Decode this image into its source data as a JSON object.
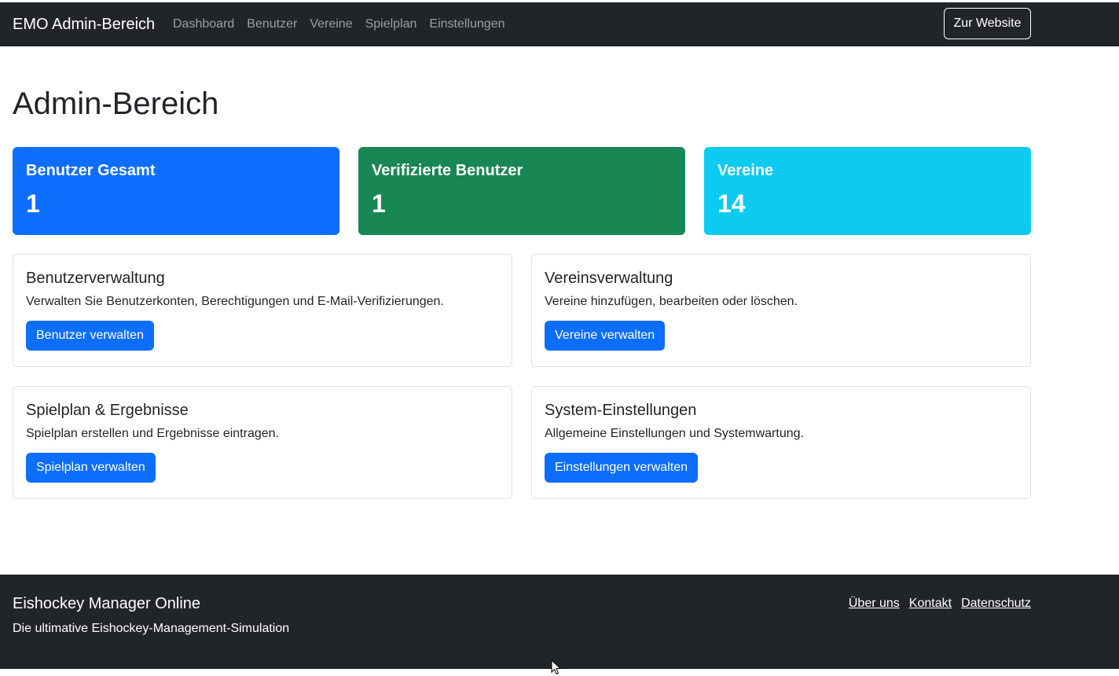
{
  "navbar": {
    "brand": "EMO Admin-Bereich",
    "links": [
      "Dashboard",
      "Benutzer",
      "Vereine",
      "Spielplan",
      "Einstellungen"
    ],
    "website_button": "Zur Website"
  },
  "page_title": "Admin-Bereich",
  "stats": [
    {
      "title": "Benutzer Gesamt",
      "value": "1",
      "color": "#0d6efd"
    },
    {
      "title": "Verifizierte Benutzer",
      "value": "1",
      "color": "#198754"
    },
    {
      "title": "Vereine",
      "value": "14",
      "color": "#0dcaf0"
    }
  ],
  "panels": [
    {
      "title": "Benutzerverwaltung",
      "text": "Verwalten Sie Benutzerkonten, Berechtigungen und E-Mail-Verifizierungen.",
      "button": "Benutzer verwalten"
    },
    {
      "title": "Vereinsverwaltung",
      "text": "Vereine hinzufügen, bearbeiten oder löschen.",
      "button": "Vereine verwalten"
    },
    {
      "title": "Spielplan & Ergebnisse",
      "text": "Spielplan erstellen und Ergebnisse eintragen.",
      "button": "Spielplan verwalten"
    },
    {
      "title": "System-Einstellungen",
      "text": "Allgemeine Einstellungen und Systemwartung.",
      "button": "Einstellungen verwalten"
    }
  ],
  "footer": {
    "title": "Eishockey Manager Online",
    "subtitle": "Die ultimative Eishockey-Management-Simulation",
    "links": [
      "Über uns",
      "Kontakt",
      "Datenschutz"
    ]
  }
}
